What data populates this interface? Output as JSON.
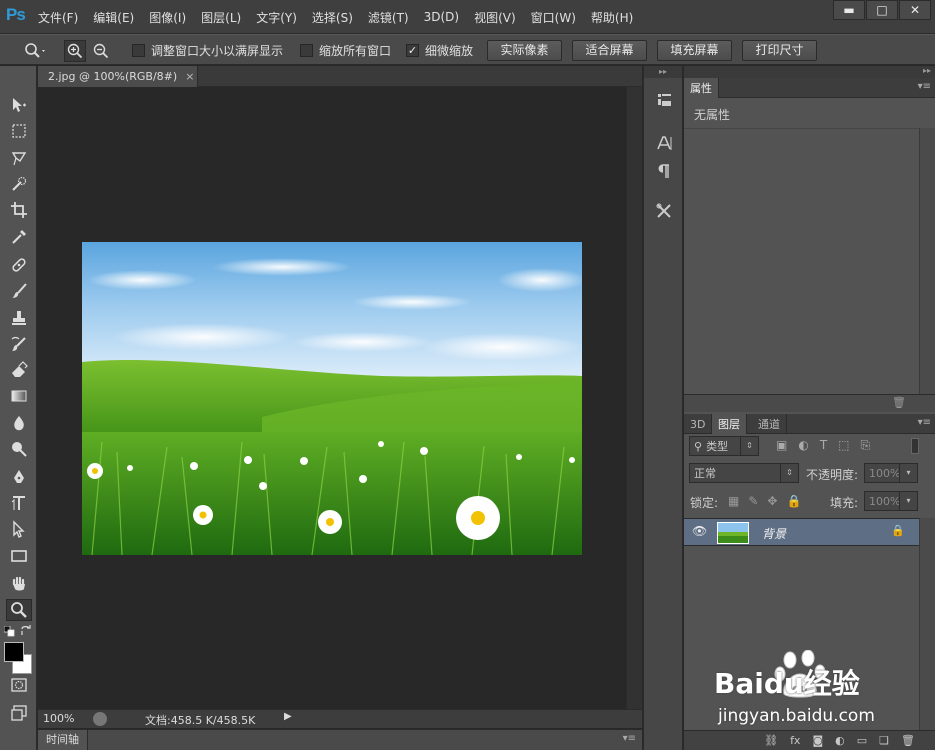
{
  "app": {
    "logo": "Ps",
    "menu": [
      "文件(F)",
      "编辑(E)",
      "图像(I)",
      "图层(L)",
      "文字(Y)",
      "选择(S)",
      "滤镜(T)",
      "3D(D)",
      "视图(V)",
      "窗口(W)",
      "帮助(H)"
    ],
    "window_buttons": {
      "minimize": "▬",
      "maximize": "□",
      "close": "✕"
    }
  },
  "options": {
    "resize_windows": {
      "label": "调整窗口大小以满屏显示",
      "checked": false
    },
    "zoom_all_windows": {
      "label": "缩放所有窗口",
      "checked": false
    },
    "scrubby_zoom": {
      "label": "细微缩放",
      "checked": true
    },
    "buttons": {
      "actual_pixels": "实际像素",
      "fit_screen": "适合屏幕",
      "fill_screen": "填充屏幕",
      "print_size": "打印尺寸"
    }
  },
  "document": {
    "tab_title": "2.jpg @ 100%(RGB/8#)",
    "tab_close": "×",
    "zoom": "100%",
    "doc_info": "文档:458.5 K/458.5K",
    "timeline_label": "时间轴"
  },
  "properties": {
    "tab": "属性",
    "content": "无属性"
  },
  "layers": {
    "tabs": [
      "3D",
      "图层",
      "通道"
    ],
    "active_tab": "图层",
    "filter_kind": "类型",
    "blend_mode": "正常",
    "opacity_label": "不透明度:",
    "opacity_value": "100%",
    "lock_label": "锁定:",
    "fill_label": "填充:",
    "fill_value": "100%",
    "items": [
      {
        "name": "背景",
        "visible": true,
        "locked": true
      }
    ]
  },
  "watermark": {
    "brand": "Baidu经验",
    "url": "jingyan.baidu.com"
  }
}
